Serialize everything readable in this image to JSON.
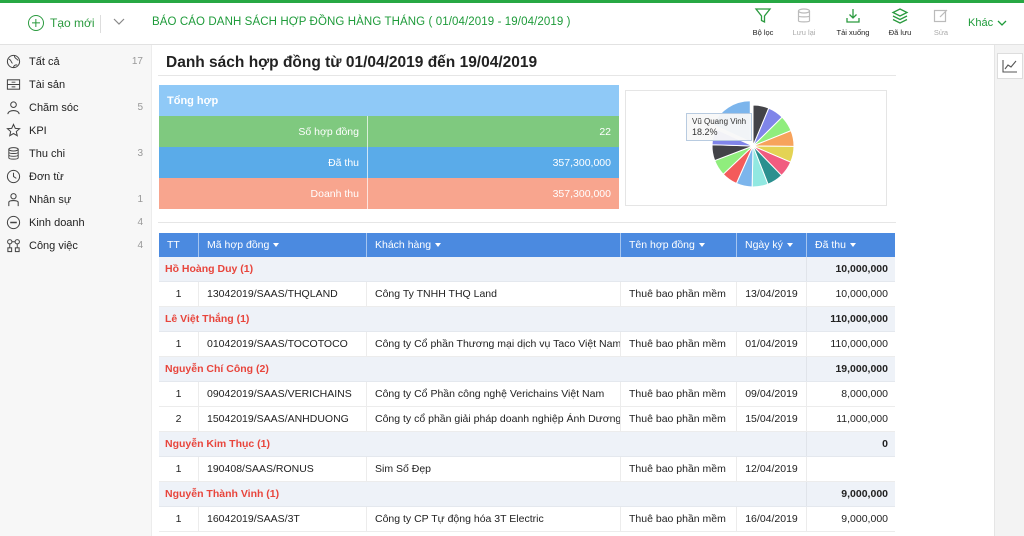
{
  "topbar": {
    "new_label": "Tạo mới",
    "report_title": "BÁO CÁO DANH SÁCH HỢP ĐỒNG HÀNG THÁNG ( 01/04/2019 - 19/04/2019 )",
    "tools": {
      "filter": "Bộ lọc",
      "save": "Lưu lại",
      "download": "Tải xuống",
      "saved": "Đã lưu",
      "edit": "Sửa"
    },
    "more_label": "Khác"
  },
  "sidebar": {
    "items": [
      {
        "label": "Tất cả",
        "count": "17"
      },
      {
        "label": "Tài sản",
        "count": ""
      },
      {
        "label": "Chăm sóc",
        "count": "5"
      },
      {
        "label": "KPI",
        "count": ""
      },
      {
        "label": "Thu chi",
        "count": "3"
      },
      {
        "label": "Đơn từ",
        "count": ""
      },
      {
        "label": "Nhân sự",
        "count": "1"
      },
      {
        "label": "Kinh doanh",
        "count": "4"
      },
      {
        "label": "Công việc",
        "count": "4"
      }
    ]
  },
  "page": {
    "title": "Danh sách hợp đồng từ 01/04/2019 đến 19/04/2019"
  },
  "summary": {
    "header": "Tổng hợp",
    "rows": [
      {
        "label": "Số hợp đồng",
        "value": "22"
      },
      {
        "label": "Đã thu",
        "value": "357,300,000"
      },
      {
        "label": "Doanh thu",
        "value": "357,300,000"
      }
    ]
  },
  "pie": {
    "tooltip_name": "Vũ Quang Vinh",
    "tooltip_pct": "18.2%",
    "highlight_pct": 18.2,
    "colors": {
      "highlight": "#7cb5ec",
      "slices": [
        "#434348",
        "#8085e9",
        "#90ed7d",
        "#f7a35c",
        "#e4d354",
        "#f15c80",
        "#2b908f",
        "#91e8e1",
        "#7cb5ec",
        "#f45b5b",
        "#90ed7d",
        "#434348",
        "#8085e9"
      ]
    }
  },
  "table": {
    "headers": {
      "tt": "TT",
      "code": "Mã hợp đồng",
      "customer": "Khách hàng",
      "name": "Tên hợp đồng",
      "date": "Ngày ký",
      "paid": "Đã thu"
    },
    "groups": [
      {
        "name": "Hồ Hoàng Duy (1)",
        "total": "10,000,000",
        "rows": [
          {
            "tt": "1",
            "code": "13042019/SAAS/THQLAND",
            "customer": "Công Ty TNHH THQ Land",
            "name": "Thuê bao phần mềm",
            "date": "13/04/2019",
            "paid": "10,000,000"
          }
        ]
      },
      {
        "name": "Lê Việt Thắng (1)",
        "total": "110,000,000",
        "rows": [
          {
            "tt": "1",
            "code": "01042019/SAAS/TOCOTOCO",
            "customer": "Công ty Cổ phần Thương mại dịch vụ Taco Việt Nam",
            "name": "Thuê bao phần mềm",
            "date": "01/04/2019",
            "paid": "110,000,000"
          }
        ]
      },
      {
        "name": "Nguyễn Chí Công (2)",
        "total": "19,000,000",
        "rows": [
          {
            "tt": "1",
            "code": "09042019/SAAS/VERICHAINS",
            "customer": "Công ty Cổ Phần công nghệ Verichains Việt Nam",
            "name": "Thuê bao phần mềm",
            "date": "09/04/2019",
            "paid": "8,000,000"
          },
          {
            "tt": "2",
            "code": "15042019/SAAS/ANHDUONG",
            "customer": "Công ty cổ phần giải pháp doanh nghiệp Ánh Dương",
            "name": "Thuê bao phần mềm",
            "date": "15/04/2019",
            "paid": "11,000,000"
          }
        ]
      },
      {
        "name": "Nguyễn Kim Thục (1)",
        "total": "0",
        "rows": [
          {
            "tt": "1",
            "code": "190408/SAAS/RONUS",
            "customer": "Sim Số Đẹp",
            "name": "Thuê bao phần mềm",
            "date": "12/04/2019",
            "paid": ""
          }
        ]
      },
      {
        "name": "Nguyễn Thành Vinh (1)",
        "total": "9,000,000",
        "rows": [
          {
            "tt": "1",
            "code": "16042019/SAAS/3T",
            "customer": "Công ty CP Tự động hóa 3T Electric",
            "name": "Thuê bao phần mềm",
            "date": "16/04/2019",
            "paid": "9,000,000"
          }
        ]
      }
    ]
  }
}
